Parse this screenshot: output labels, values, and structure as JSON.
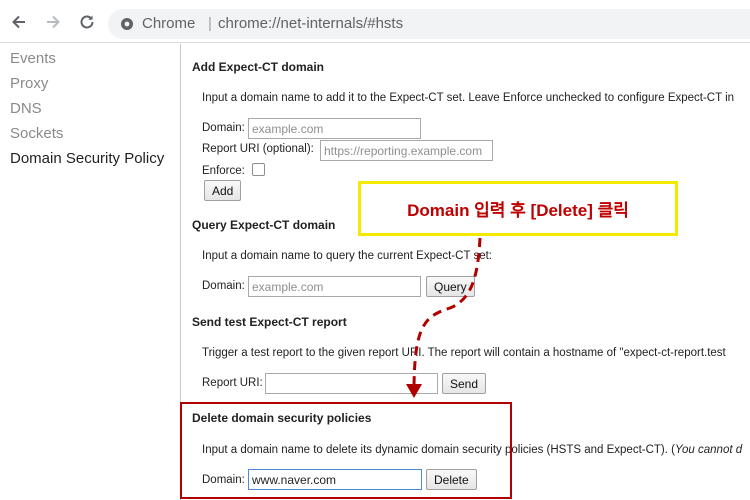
{
  "browser": {
    "site_chip": "Chrome",
    "separator": "|",
    "url": "chrome://net-internals/#hsts"
  },
  "sidebar": {
    "items": [
      {
        "label": "Events"
      },
      {
        "label": "Proxy"
      },
      {
        "label": "DNS"
      },
      {
        "label": "Sockets"
      },
      {
        "label": "Domain Security Policy",
        "selected": true
      }
    ]
  },
  "add_section": {
    "title": "Add Expect-CT domain",
    "description": "Input a domain name to add it to the Expect-CT set. Leave Enforce unchecked to configure Expect-CT in",
    "domain_label": "Domain:",
    "domain_placeholder": "example.com",
    "report_label": "Report URI (optional):",
    "report_placeholder": "https://reporting.example.com",
    "enforce_label": "Enforce:",
    "add_button": "Add"
  },
  "query_section": {
    "title": "Query Expect-CT domain",
    "description": "Input a domain name to query the current Expect-CT set:",
    "domain_label": "Domain:",
    "domain_placeholder": "example.com",
    "query_button": "Query"
  },
  "report_section": {
    "title": "Send test Expect-CT report",
    "description": "Trigger a test report to the given report URI. The report will contain a hostname of \"expect-ct-report.test",
    "report_label": "Report URI:",
    "send_button": "Send"
  },
  "delete_section": {
    "title": "Delete domain security policies",
    "description": "Input a domain name to delete its dynamic domain security policies (HSTS and Expect-CT). (",
    "description_italic": "You cannot d",
    "domain_label": "Domain:",
    "domain_value": "www.naver.com",
    "delete_button": "Delete"
  },
  "annotation": {
    "callout_text": "Domain 입력 후 [Delete] 클릭",
    "callout_border_color": "#f5e900",
    "callout_text_color": "#c00000",
    "highlight_color": "#b20000"
  }
}
